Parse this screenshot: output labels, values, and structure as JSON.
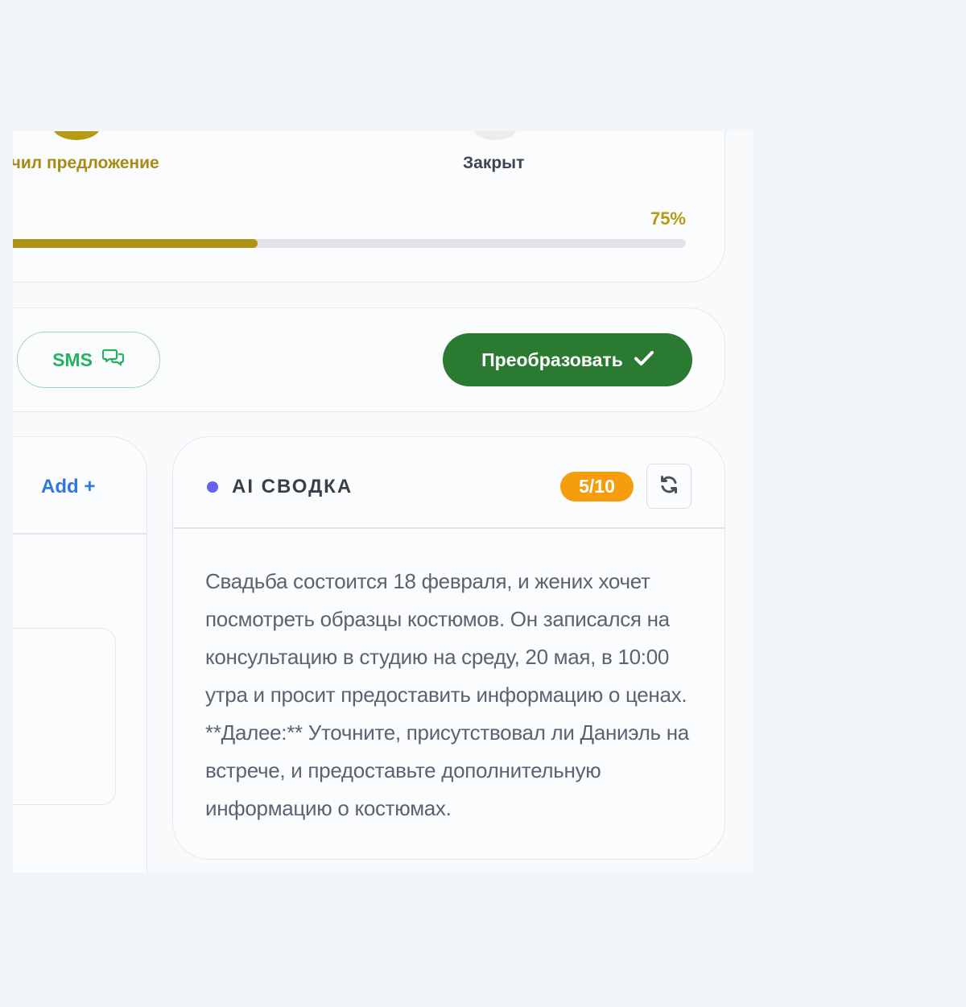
{
  "pipeline": {
    "steps": [
      {
        "label": "учил предложение",
        "state": "active"
      },
      {
        "label": "Закрыт",
        "state": "inactive"
      }
    ],
    "progress_percent": 75,
    "progress_label": "75%",
    "accent_color": "#b59a12"
  },
  "actions": {
    "sms_label": "SMS",
    "sms_icon": "chat-bubbles-icon",
    "convert_label": "Преобразовать",
    "convert_icon": "checkmark-icon",
    "convert_color": "#2a7a31"
  },
  "side_panel": {
    "add_label": "Add +"
  },
  "ai_summary": {
    "title": "AI СВОДКА",
    "score": "5/10",
    "refresh_icon": "refresh-icon",
    "text": "Свадьба состоится 18 февраля, и жених хочет посмотреть образцы костюмов. Он записался на консультацию в студию на среду, 20 мая, в 10:00 утра и просит предоставить информацию о ценах. **Далее:** Уточните, присутствовал ли Даниэль на встрече, и предоставьте дополнительную информацию о костюмах."
  }
}
